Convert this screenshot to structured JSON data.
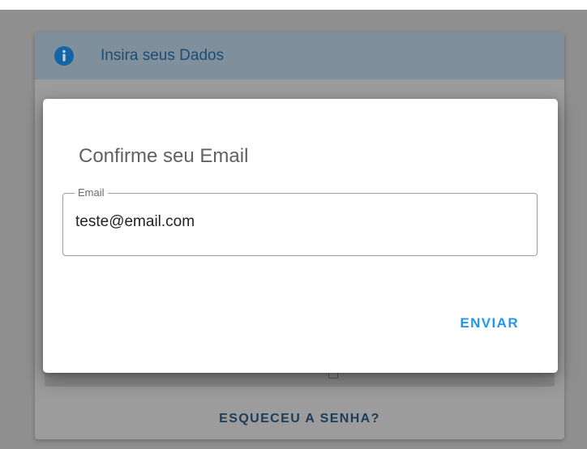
{
  "background_page": {
    "header_title": "Insira seus Dados",
    "forgot_password_label": "ESQUECEU A SENHA?"
  },
  "dialog": {
    "title": "Confirme seu Email",
    "email_field": {
      "label": "Email",
      "value": "teste@email.com"
    },
    "send_label": "ENVIAR"
  },
  "colors": {
    "accent": "#2196f3",
    "info_icon": "#1976d2"
  },
  "icons": {
    "header": "info-icon",
    "checkbox": "checkbox-icon"
  }
}
